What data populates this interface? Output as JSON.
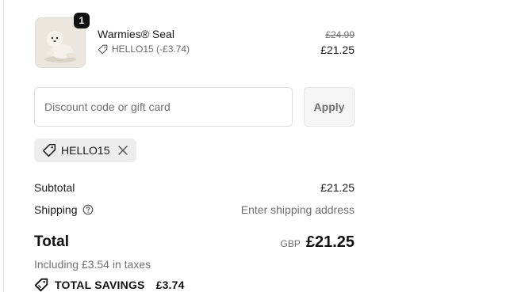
{
  "product": {
    "name": "Warmies® Seal",
    "quantity": "1",
    "discount_line": "HELLO15 (-£3.74)",
    "original_price": "£24.99",
    "price": "£21.25"
  },
  "discount": {
    "placeholder": "Discount code or gift card",
    "value": "",
    "apply_label": "Apply",
    "applied_code": "HELLO15"
  },
  "summary": {
    "subtotal_label": "Subtotal",
    "subtotal_value": "£21.25",
    "shipping_label": "Shipping",
    "shipping_value": "Enter shipping address",
    "total_label": "Total",
    "currency": "GBP",
    "total_value": "£21.25",
    "tax_note": "Including £3.54 in taxes",
    "savings_label": "TOTAL SAVINGS",
    "savings_value": "£3.74"
  },
  "icons": {
    "tag": "tag-icon",
    "close": "close-icon",
    "help": "help-circle-icon",
    "savings": "savings-tag-icon"
  }
}
